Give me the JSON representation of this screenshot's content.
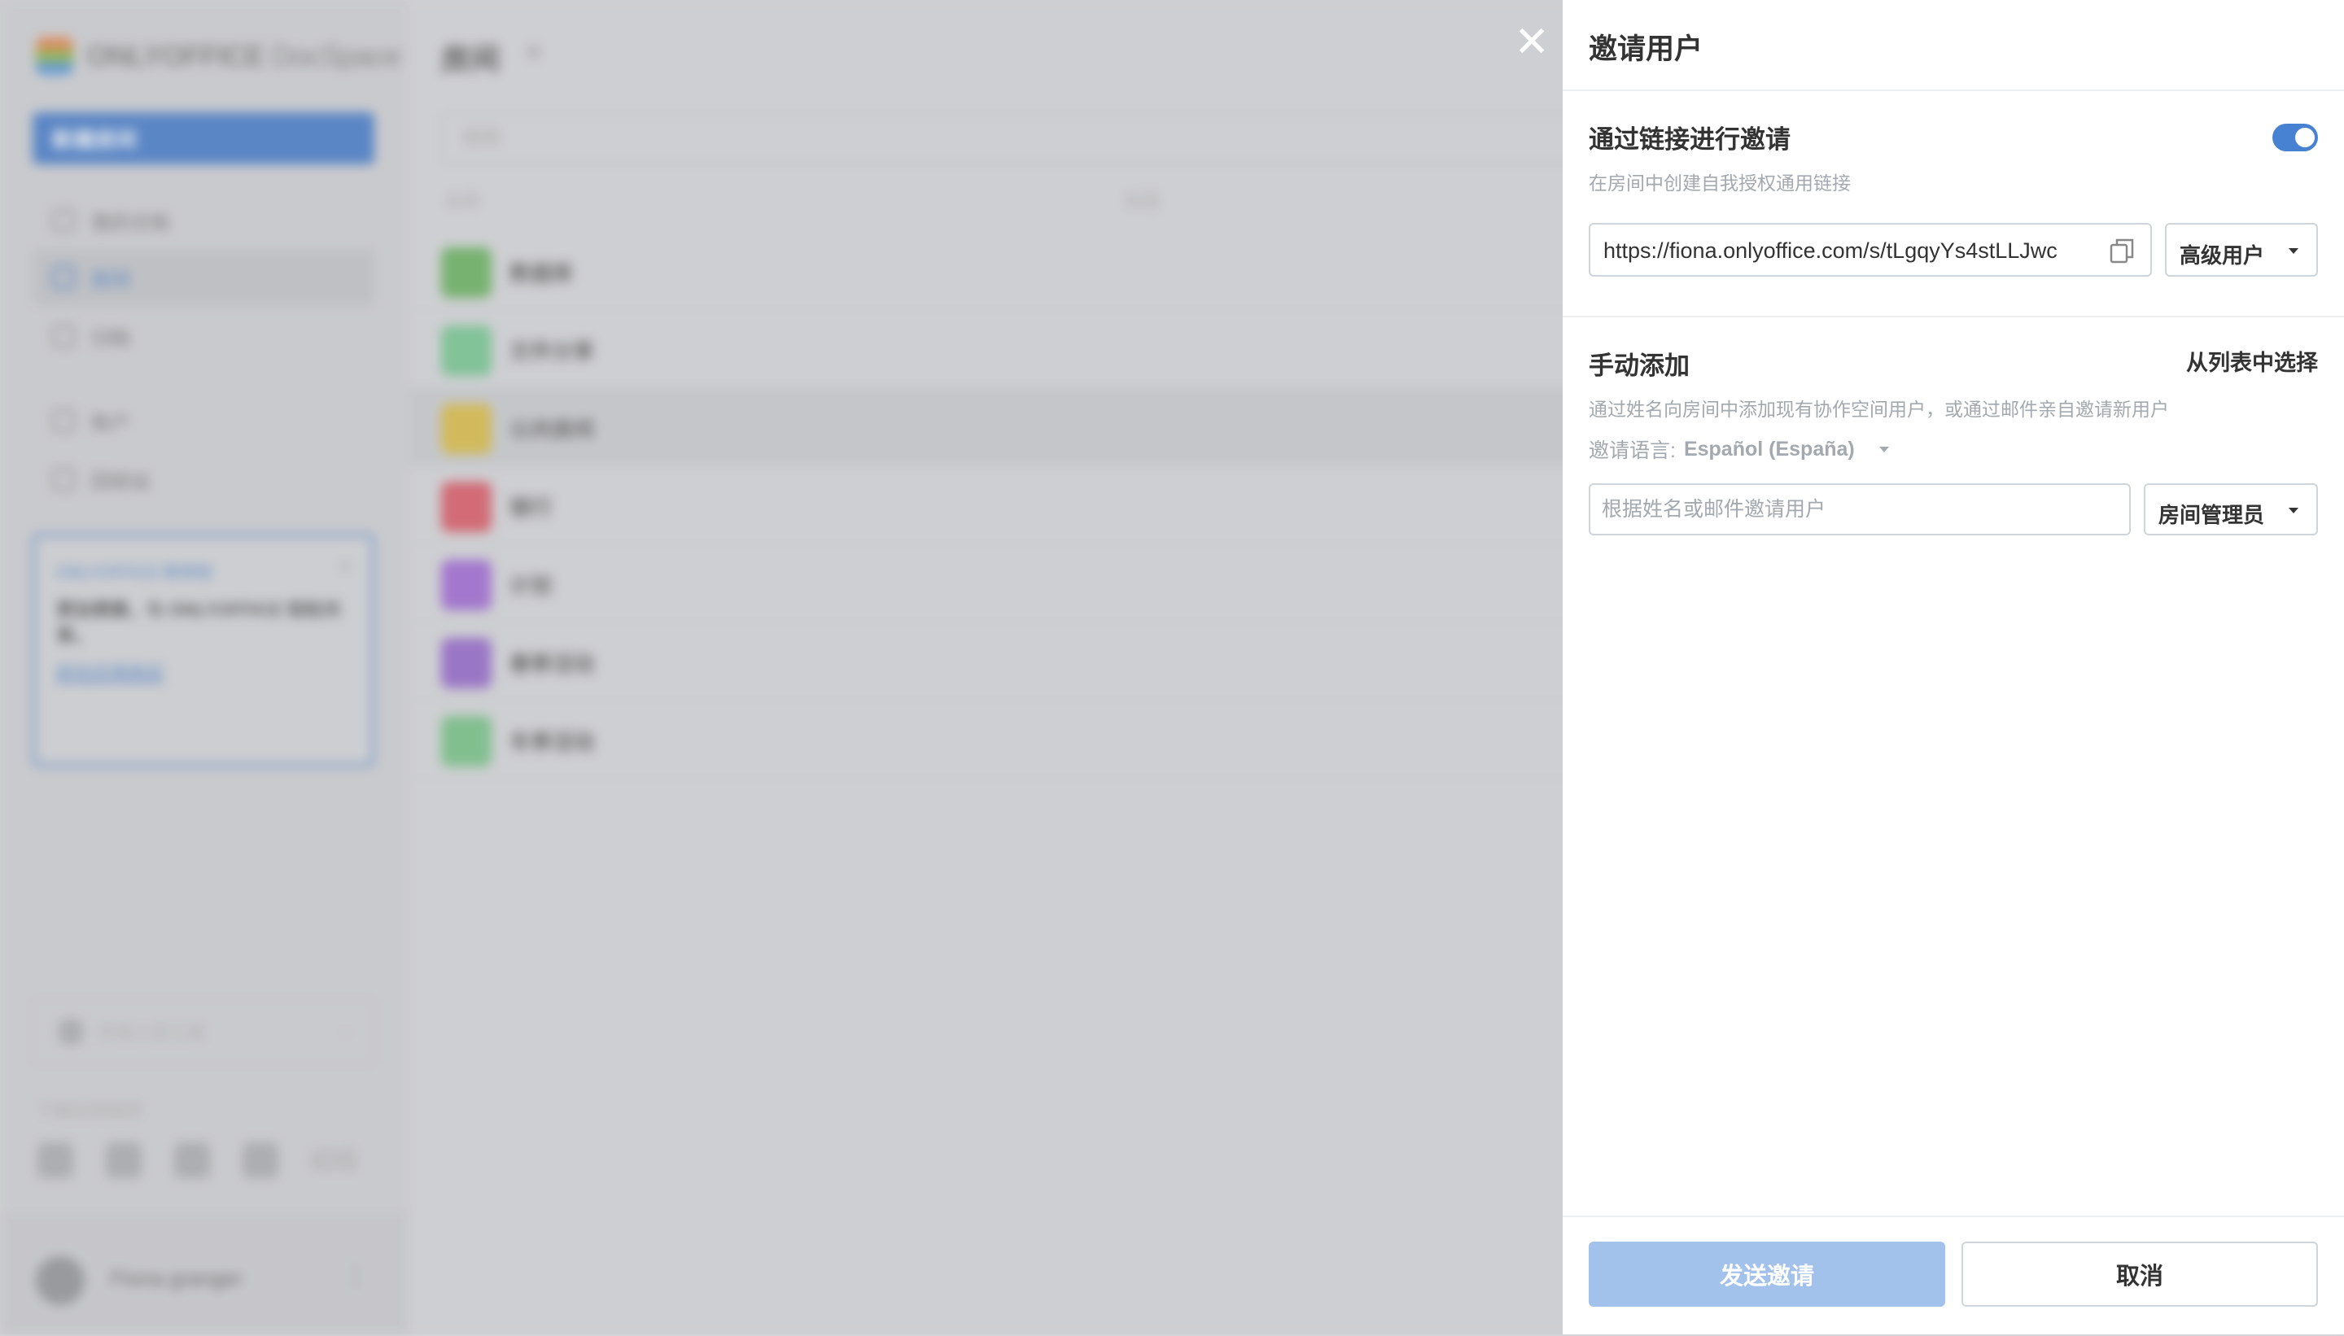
{
  "background": {
    "logo": {
      "brand": "ONLYOFFICE",
      "product": "DocSpace"
    },
    "sidebar": {
      "new_room_label": "新建房间",
      "items": [
        {
          "label": "我的文档",
          "icon": "person-icon"
        },
        {
          "label": "房间",
          "icon": "rooms-icon",
          "active": true
        },
        {
          "label": "归档",
          "icon": "archive-icon"
        },
        {
          "label": "账户",
          "icon": "accounts-icon"
        },
        {
          "label": "回收站",
          "icon": "trash-icon"
        }
      ],
      "promo": {
        "title": "ONLYOFFICE 新体验",
        "body": "更加便捷，与 ONLYOFFICE 轻松共享。",
        "link": "前往应用商店"
      },
      "dev_tools": "开发人员工具",
      "download_label": "下载应用程序",
      "os_last": "iOS",
      "user_name": "Fiona granger"
    },
    "main": {
      "title": "房间",
      "search_placeholder": "搜索",
      "col_name": "名称",
      "col_tags": "标签",
      "rows": [
        {
          "name": "数据库",
          "color": "#5fae54"
        },
        {
          "name": "文件分享",
          "color": "#6ec48a"
        },
        {
          "name": "公共房间",
          "color": "#d8b93a"
        },
        {
          "name": "银行",
          "color": "#d84f5c"
        },
        {
          "name": "计划",
          "color": "#9a5fd1"
        },
        {
          "name": "春季活动",
          "color": "#8e5ec7"
        },
        {
          "name": "冬季活动",
          "color": "#6dbf7e"
        }
      ]
    }
  },
  "panel": {
    "title": "邀请用户",
    "link_section": {
      "title": "通过链接进行邀请",
      "description": "在房间中创建自我授权通用链接",
      "enabled": true,
      "url": "https://fiona.onlyoffice.com/s/tLgqyYs4stLLJwc",
      "access": "高级用户"
    },
    "manual_section": {
      "title": "手动添加",
      "from_list": "从列表中选择",
      "description": "通过姓名向房间中添加现有协作空间用户，或通过邮件亲自邀请新用户",
      "lang_label": "邀请语言:",
      "lang_value": "Español (España)",
      "input_placeholder": "根据姓名或邮件邀请用户",
      "role": "房间管理员"
    },
    "footer": {
      "send": "发送邀请",
      "cancel": "取消"
    }
  },
  "colors": {
    "accent": "#4781d1",
    "send_disabled": "#a3c2eb",
    "muted_text": "#a3a9ae"
  }
}
